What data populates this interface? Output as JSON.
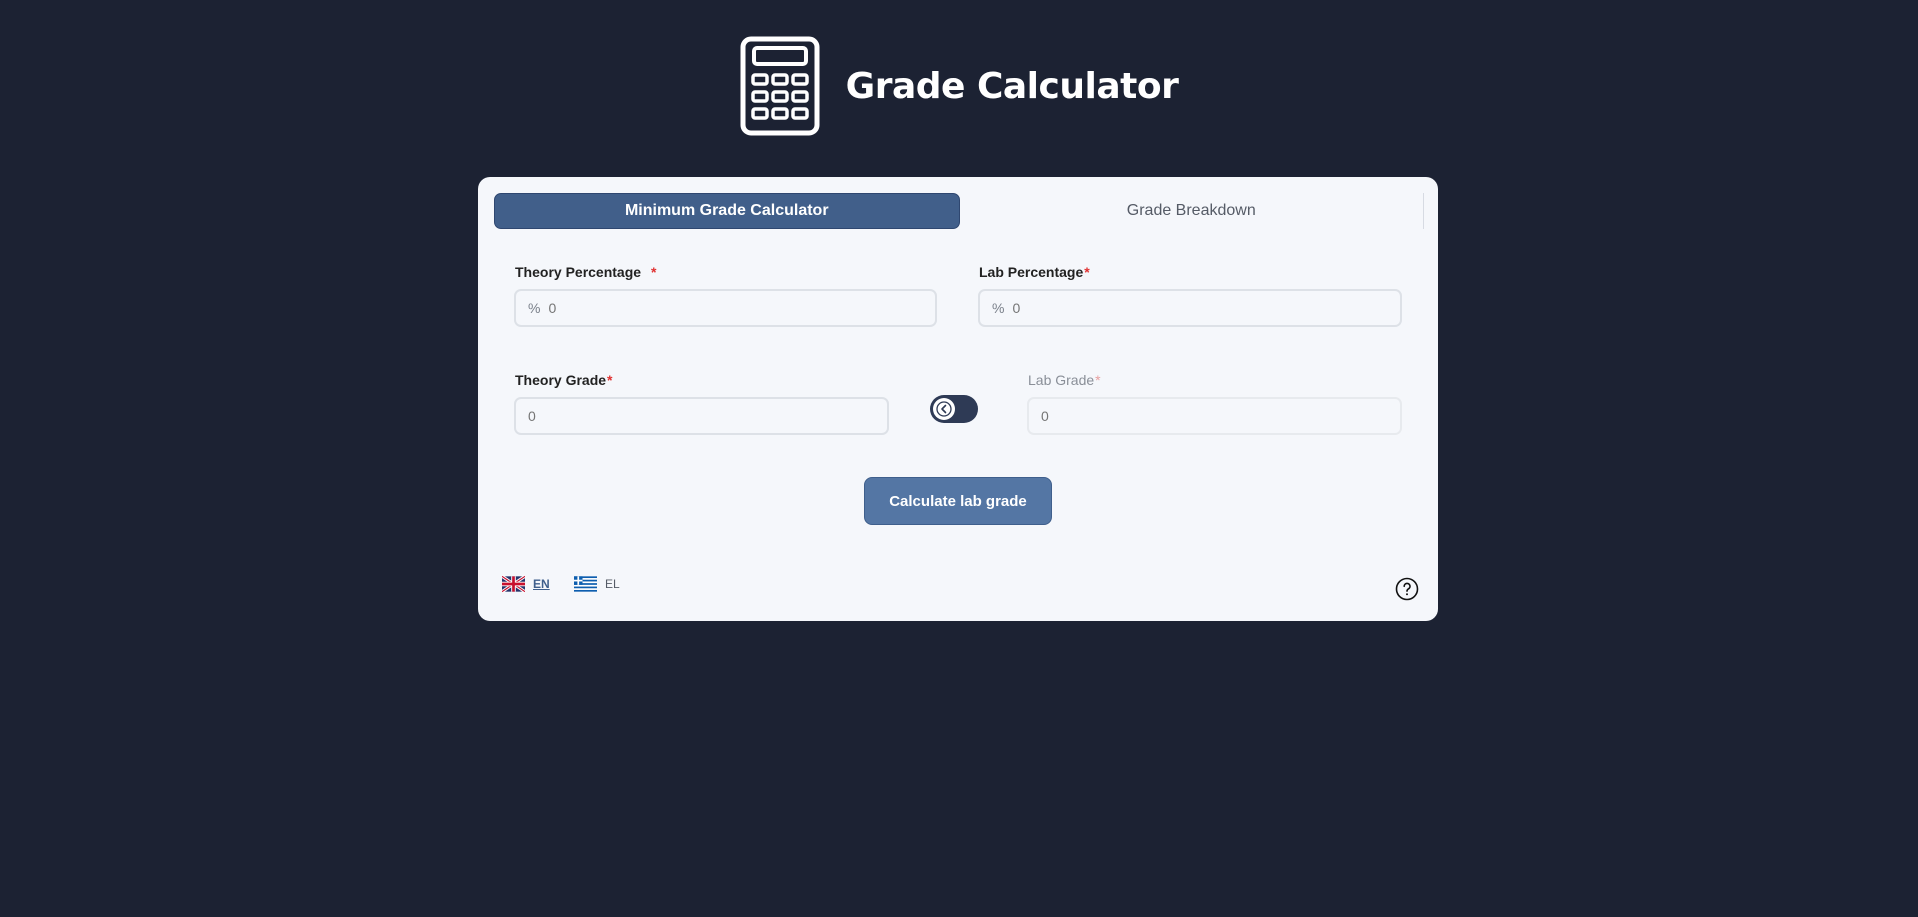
{
  "header": {
    "title": "Grade Calculator",
    "logo_icon": "calculator-icon"
  },
  "tabs": [
    {
      "label": "Minimum Grade Calculator",
      "active": true
    },
    {
      "label": "Grade Breakdown",
      "active": false
    }
  ],
  "form": {
    "theory_percentage": {
      "label": "Theory Percentage",
      "required_mark": "*",
      "prefix": "%",
      "placeholder": "0"
    },
    "lab_percentage": {
      "label": "Lab Percentage",
      "required_mark": "*",
      "prefix": "%",
      "placeholder": "0"
    },
    "theory_grade": {
      "label": "Theory Grade",
      "required_mark": "*",
      "placeholder": "0"
    },
    "lab_grade": {
      "label": "Lab Grade",
      "required_mark": "*",
      "placeholder": "0",
      "disabled": true
    },
    "toggle_icon": "chevron-left-icon",
    "calculate_label": "Calculate lab grade"
  },
  "languages": [
    {
      "code": "EN",
      "flag": "uk-flag-icon",
      "active": true
    },
    {
      "code": "EL",
      "flag": "greece-flag-icon",
      "active": false
    }
  ],
  "help_icon": "help-circle-icon",
  "colors": {
    "background": "#1c2233",
    "card": "#f5f7fb",
    "accent": "#415f8a",
    "button": "#5476a4",
    "required": "#e03131"
  }
}
